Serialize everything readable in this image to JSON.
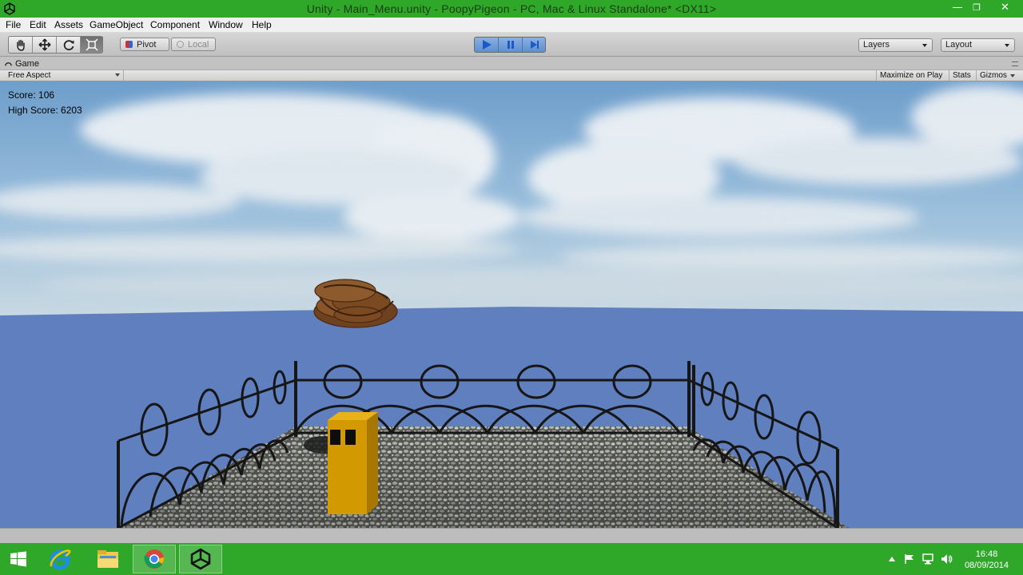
{
  "window": {
    "title": "Unity - Main_Menu.unity - PoopyPigeon - PC, Mac & Linux Standalone* <DX11>",
    "minimize_glyph": "—",
    "maximize_glyph": "❐",
    "close_glyph": "✕"
  },
  "menu": {
    "items": [
      "File",
      "Edit",
      "Assets",
      "GameObject",
      "Component",
      "Window",
      "Help"
    ]
  },
  "toolbar": {
    "pivot_label": "Pivot",
    "local_label": "Local",
    "layers_label": "Layers",
    "layout_label": "Layout"
  },
  "game_view": {
    "tab_label": "Game",
    "aspect_label": "Free Aspect",
    "maximize_label": "Maximize on Play",
    "stats_label": "Stats",
    "gizmos_label": "Gizmos"
  },
  "hud": {
    "score": "Score: 106",
    "high_score": "High Score: 6203"
  },
  "taskbar": {
    "time": "16:48",
    "date": "08/09/2014"
  },
  "colors": {
    "titlebar": "#2fa82a",
    "sea": "#5f7fbf",
    "character": "#d39a00",
    "poop": "#7b4a22"
  }
}
